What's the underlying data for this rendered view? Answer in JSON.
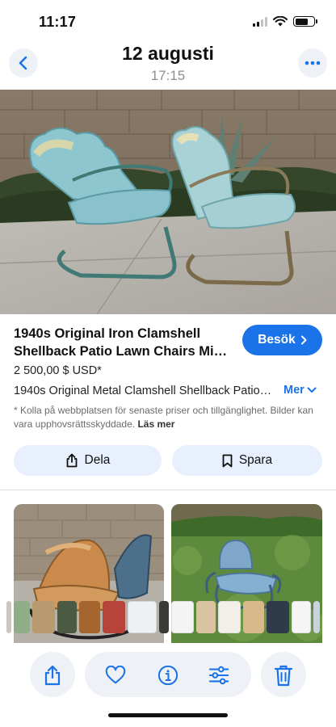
{
  "status": {
    "time": "11:17"
  },
  "header": {
    "title": "12 augusti",
    "subtitle": "17:15"
  },
  "listing": {
    "title": "1940s Original Iron Clamshell Shellback Patio Lawn Chairs Mi…",
    "visit_label": "Besök",
    "price": "2 500,00 $ USD*",
    "description": "1940s Original Metal Clamshell Shellback Patio…",
    "more_label": "Mer",
    "note": "* Kolla på webbplatsen för senaste priser och tillgänglighet. Bilder kan vara upphovsrättsskyddade.",
    "read_more_label": "Läs mer",
    "share_label": "Dela",
    "save_label": "Spara"
  },
  "colors": {
    "accent": "#1a73e8",
    "pill_bg": "#e8f0fe",
    "toolbar_bg": "#eef1f6"
  },
  "icons": {
    "back": "chevron-left-icon",
    "more": "ellipsis-icon",
    "visit": "chevron-right-icon",
    "share": "share-icon",
    "save": "bookmark-icon",
    "favorite": "heart-icon",
    "info": "info-icon",
    "adjust": "sliders-icon",
    "delete": "trash-icon"
  }
}
